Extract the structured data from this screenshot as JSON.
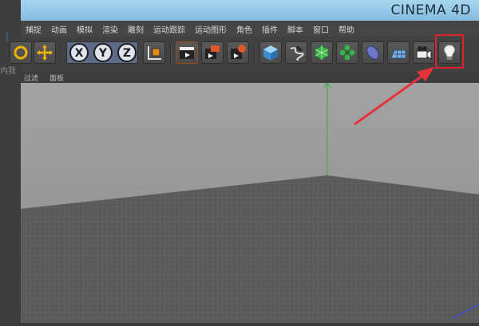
{
  "window": {
    "title": "CINEMA 4D"
  },
  "left_fragments": {
    "label": "内我"
  },
  "menu": [
    "捕捉",
    "动画",
    "模拟",
    "渲染",
    "雕刻",
    "运动跟踪",
    "运动图形",
    "角色",
    "插件",
    "脚本",
    "窗口",
    "帮助"
  ],
  "toolbar": {
    "axis_x": "X",
    "axis_y": "Y",
    "axis_z": "Z"
  },
  "subbar": {
    "items": [
      "过滤",
      "面板"
    ]
  },
  "colors": {
    "title_bg": "#9ccbe8",
    "highlight": "#e0202a",
    "arrow": "#e8323a",
    "viewport_bg": "#9b9b9b",
    "floor": "#5a5a5a",
    "axis_green": "#3fae4b",
    "axis_blue": "#3c4dd6"
  },
  "icons": [
    "move-icon",
    "axis-x-icon",
    "axis-y-icon",
    "axis-z-icon",
    "coordinate-system-icon",
    "render-view-icon",
    "render-picture-viewer-icon",
    "render-settings-icon",
    "cube-icon",
    "spline-pen-icon",
    "subdivision-surface-icon",
    "array-icon",
    "deformer-icon",
    "floor-icon",
    "camera-icon",
    "light-bulb-icon"
  ]
}
